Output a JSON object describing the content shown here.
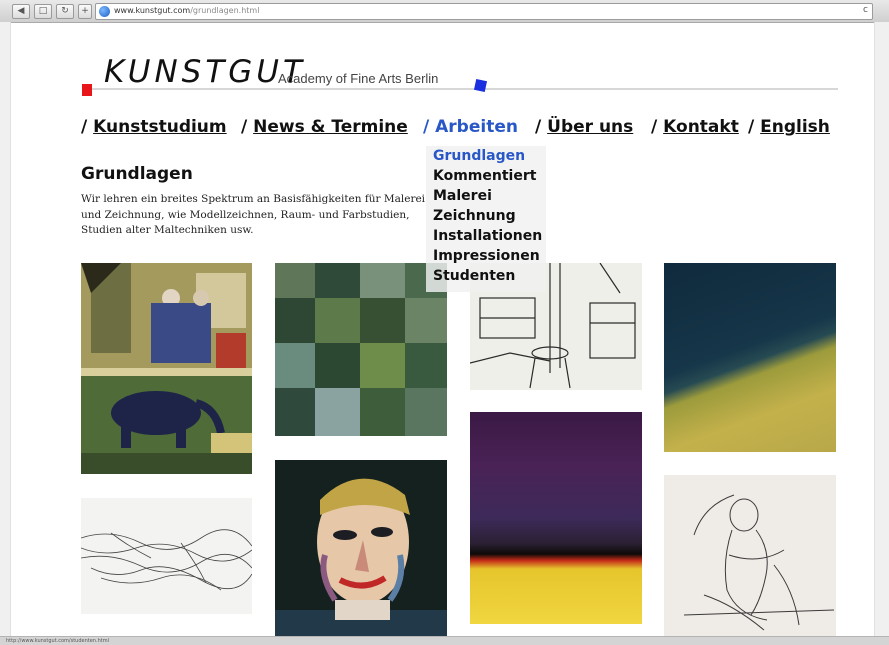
{
  "browser": {
    "url_host": "www.kunstgut.com",
    "url_path": "/grundlagen.html",
    "status_text": "http://www.kunstgut.com/studenten.html"
  },
  "header": {
    "logo": "KUNSTGUT",
    "tagline": "Academy of Fine Arts Berlin"
  },
  "nav": {
    "items": [
      {
        "slash": "/ ",
        "label": "Kunststudium"
      },
      {
        "slash": "/ ",
        "label": "News & Termine"
      },
      {
        "slash": "/ ",
        "label": "Arbeiten"
      },
      {
        "slash": "/ ",
        "label": "Über uns"
      },
      {
        "slash": "/ ",
        "label": "Kontakt"
      },
      {
        "slash": "/ ",
        "label": "English"
      }
    ],
    "active": "Arbeiten"
  },
  "dropdown": {
    "items": [
      "Grundlagen",
      "Kommentiert",
      "Malerei",
      "Zeichnung",
      "Installationen",
      "Impressionen",
      "Studenten"
    ],
    "selected": "Grundlagen"
  },
  "content": {
    "title": "Grundlagen",
    "intro": "Wir lehren ein breites Spektrum an Basisfähigkeiten für Malerei und Zeichnung, wie Modellzeichnen, Raum- und Farbstudien, Studien alter Maltechniken usw."
  },
  "colors": {
    "accent": "#2957c7",
    "red_square": "#e8161b",
    "blue_square": "#1a2fe0"
  },
  "gallery": {
    "images": [
      "zoo-painting",
      "green-checker-painting",
      "studio-sketch",
      "blue-yellow-landscape",
      "line-drawing",
      "portrait-painting",
      "purple-red-yellow-painting",
      "figure-drawing"
    ]
  }
}
